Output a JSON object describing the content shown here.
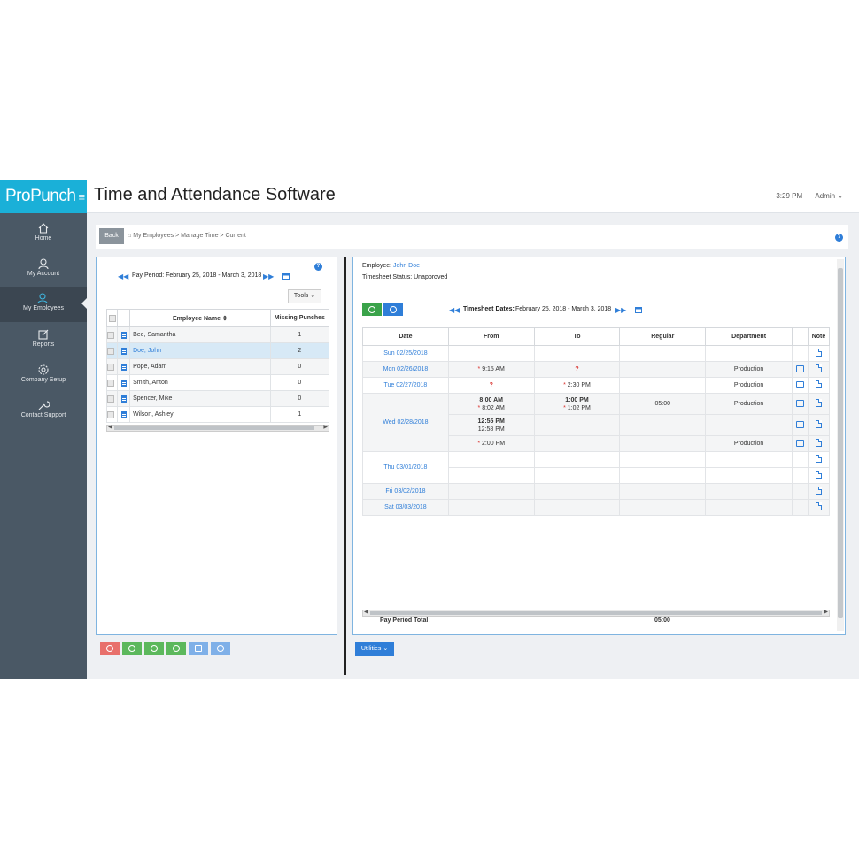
{
  "app": {
    "logo": "ProPunch",
    "title": "Time and Attendance Software",
    "time": "3:29 PM",
    "user": "Admin ⌄"
  },
  "sidebar": {
    "items": [
      {
        "label": "Home"
      },
      {
        "label": "My Account"
      },
      {
        "label": "My Employees"
      },
      {
        "label": "Reports"
      },
      {
        "label": "Company Setup"
      },
      {
        "label": "Contact Support"
      }
    ]
  },
  "breadcrumb": {
    "back": "Back",
    "path": "My Employees  >  Manage Time  >  Current"
  },
  "left": {
    "period": "Pay Period: February 25, 2018 - March 3, 2018",
    "tools": "Tools ⌄",
    "headers": {
      "name": "Employee Name ⇕",
      "missing": "Missing Punches"
    },
    "rows": [
      {
        "name": "Bee, Samantha",
        "missing": "1"
      },
      {
        "name": "Doe, John",
        "missing": "2"
      },
      {
        "name": "Pope, Adam",
        "missing": "0"
      },
      {
        "name": "Smith, Anton",
        "missing": "0"
      },
      {
        "name": "Spencer, Mike",
        "missing": "0"
      },
      {
        "name": "Wilson, Ashley",
        "missing": "1"
      }
    ],
    "button_colors": [
      "#e8706b",
      "#5cb85c",
      "#5cb85c",
      "#5cb85c",
      "#7fb0e8",
      "#7fb0e8"
    ]
  },
  "right": {
    "employee_label": "Employee:",
    "employee": "John Doe",
    "status": "Timesheet Status: Unapproved",
    "dates_label": "Timesheet Dates:",
    "dates": "February 25, 2018 - March 3, 2018",
    "headers": {
      "date": "Date",
      "from": "From",
      "to": "To",
      "regular": "Regular",
      "dept": "Department",
      "note": "Note"
    },
    "rows": [
      {
        "date": "Sun 02/25/2018"
      },
      {
        "date": "Mon 02/26/2018",
        "from": "9:15 AM",
        "to": "?",
        "dept": "Production"
      },
      {
        "date": "Tue 02/27/2018",
        "from": "?",
        "to": "2:30 PM",
        "dept": "Production"
      },
      {
        "date": "Wed 02/28/2018",
        "r1_from_a": "8:00 AM",
        "r1_from_b": "8:02 AM",
        "r1_to_a": "1:00 PM",
        "r1_to_b": "1:02 PM",
        "r1_reg": "05:00",
        "r1_dept": "Production",
        "r2_from_a": "12:55 PM",
        "r2_from_b": "12:58 PM",
        "r3_from": "2:00 PM",
        "r3_dept": "Production"
      },
      {
        "date": "Thu 03/01/2018"
      },
      {
        "date": "Fri 03/02/2018"
      },
      {
        "date": "Sat 03/03/2018"
      }
    ],
    "total_label": "Pay Period Total:",
    "total_value": "05:00",
    "utilities": "Utilities ⌄"
  }
}
